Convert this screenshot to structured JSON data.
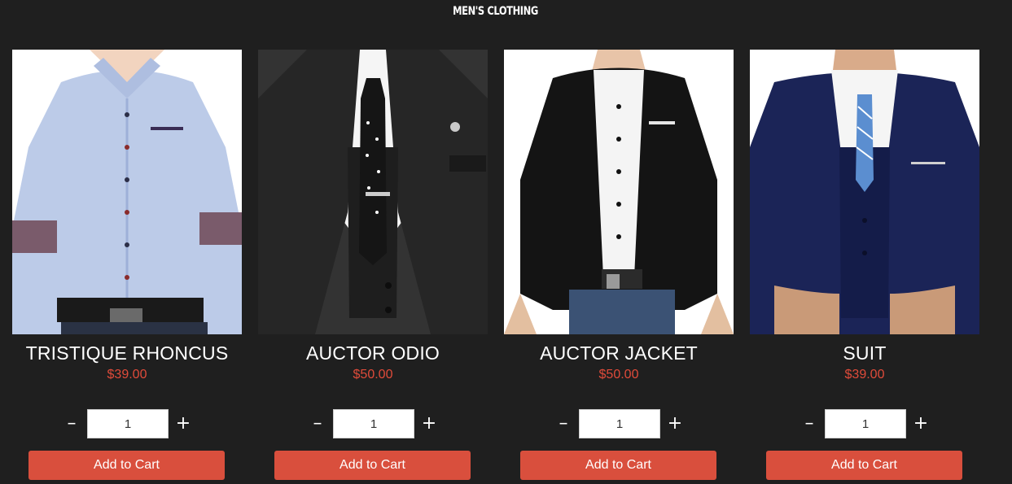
{
  "page": {
    "title": "MEN'S CLOTHING"
  },
  "colors": {
    "background": "#1f1f1f",
    "price": "#e04b3a",
    "button": "#d94f3d"
  },
  "products": [
    {
      "name": "TRISTIQUE RHONCUS",
      "price": "$39.00",
      "quantity": "1",
      "minus": "–",
      "plus": "+",
      "add_label": "Add to Cart",
      "image": "light-blue-dress-shirt"
    },
    {
      "name": "AUCTOR ODIO",
      "price": "$50.00",
      "quantity": "1",
      "minus": "–",
      "plus": "+",
      "add_label": "Add to Cart",
      "image": "charcoal-suit-polka-tie"
    },
    {
      "name": "AUCTOR JACKET",
      "price": "$50.00",
      "quantity": "1",
      "minus": "–",
      "plus": "+",
      "add_label": "Add to Cart",
      "image": "black-blazer-white-shirt"
    },
    {
      "name": "SUIT",
      "price": "$39.00",
      "quantity": "1",
      "minus": "–",
      "plus": "+",
      "add_label": "Add to Cart",
      "image": "navy-three-piece-suit"
    }
  ]
}
